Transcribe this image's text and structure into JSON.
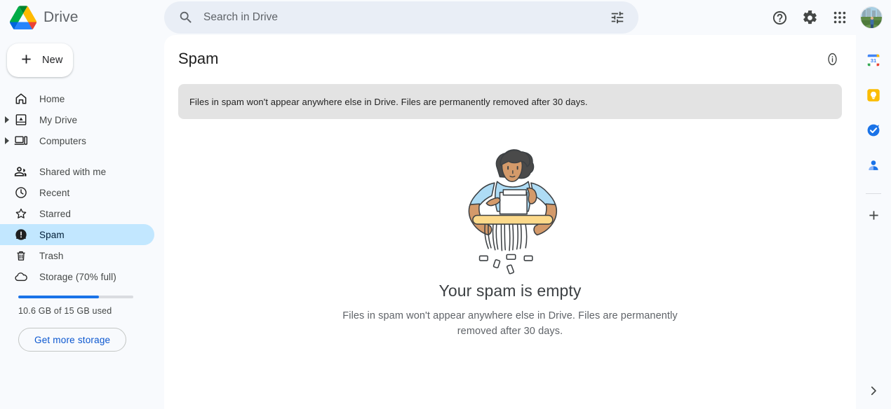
{
  "app": {
    "brand_name": "Drive",
    "logo_icon": "google-drive-logo"
  },
  "search": {
    "placeholder": "Search in Drive",
    "value": "",
    "search_icon": "search-icon",
    "filter_icon": "tune-filter-icon"
  },
  "top_actions": [
    {
      "name": "help",
      "icon": "help-circle-icon",
      "label": "Support"
    },
    {
      "name": "settings",
      "icon": "gear-icon",
      "label": "Settings"
    },
    {
      "name": "apps",
      "icon": "apps-grid-icon",
      "label": "Google apps"
    },
    {
      "name": "account",
      "icon": "avatar-photo",
      "label": "Google Account"
    }
  ],
  "sidebar": {
    "new_button": {
      "label": "New",
      "icon": "plus-icon"
    },
    "items": [
      {
        "label": "Home",
        "icon": "home-icon",
        "active": false,
        "expandable": false
      },
      {
        "label": "My Drive",
        "icon": "my-drive-icon",
        "active": false,
        "expandable": true
      },
      {
        "label": "Computers",
        "icon": "computer-icon",
        "active": false,
        "expandable": true
      },
      {
        "label": "Shared with me",
        "icon": "people-icon",
        "active": false,
        "expandable": false
      },
      {
        "label": "Recent",
        "icon": "clock-icon",
        "active": false,
        "expandable": false
      },
      {
        "label": "Starred",
        "icon": "star-icon",
        "active": false,
        "expandable": false
      },
      {
        "label": "Spam",
        "icon": "spam-exclamation-icon",
        "active": true,
        "expandable": false
      },
      {
        "label": "Trash",
        "icon": "trash-icon",
        "active": false,
        "expandable": false
      },
      {
        "label": "Storage (70% full)",
        "icon": "cloud-icon",
        "active": false,
        "expandable": false
      }
    ],
    "storage": {
      "percent_full": 70,
      "usage_text": "10.6 GB of 15 GB used",
      "get_more_label": "Get more storage"
    }
  },
  "main": {
    "title": "Spam",
    "info_icon": "info-circle-icon",
    "notice": "Files in spam won't appear anywhere else in Drive. Files are permanently removed after 30 days.",
    "empty_state": {
      "illustration": "paper-shredder-illustration",
      "title": "Your spam is empty",
      "subtitle": "Files in spam won't appear anywhere else in Drive. Files are permanently removed after 30 days."
    }
  },
  "right_rail": {
    "apps": [
      {
        "name": "calendar",
        "icon": "google-calendar-icon",
        "badge": "31"
      },
      {
        "name": "keep",
        "icon": "google-keep-icon"
      },
      {
        "name": "tasks",
        "icon": "google-tasks-icon"
      },
      {
        "name": "contacts",
        "icon": "google-contacts-icon"
      }
    ],
    "add_button": {
      "icon": "plus-icon",
      "label": "Get add-ons"
    },
    "collapse_button": {
      "icon": "chevron-right-icon",
      "label": "Hide side panel"
    }
  },
  "colors": {
    "page_bg": "#f8fafd",
    "panel_bg": "#ffffff",
    "active_pill": "#c2e7ff",
    "accent_blue": "#1a73e8",
    "link_blue": "#0b57d0",
    "notice_bg": "#e3e3e3",
    "search_bg": "#e9eef6"
  }
}
